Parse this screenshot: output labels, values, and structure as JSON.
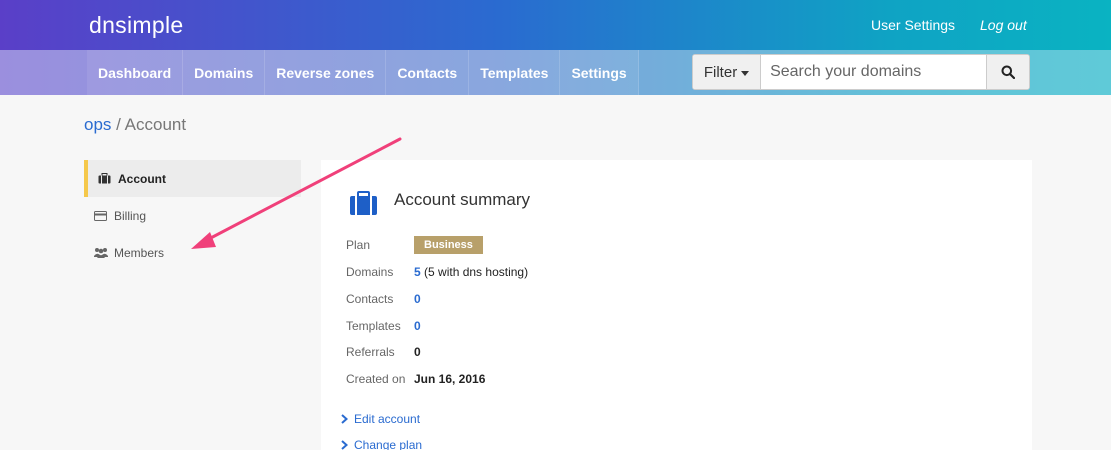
{
  "header": {
    "logo": "dnsimple",
    "user_settings": "User Settings",
    "logout": "Log out"
  },
  "nav": {
    "tabs": [
      {
        "label": "Dashboard"
      },
      {
        "label": "Domains"
      },
      {
        "label": "Reverse zones"
      },
      {
        "label": "Contacts"
      },
      {
        "label": "Templates"
      },
      {
        "label": "Settings"
      }
    ]
  },
  "search": {
    "filter_label": "Filter",
    "placeholder": "Search your domains",
    "value": ""
  },
  "breadcrumb": {
    "account_name": "ops",
    "separator": " / ",
    "current": "Account"
  },
  "sidebar": {
    "items": [
      {
        "label": "Account",
        "icon": "briefcase-icon",
        "active": true
      },
      {
        "label": "Billing",
        "icon": "credit-card-icon",
        "active": false
      },
      {
        "label": "Members",
        "icon": "users-icon",
        "active": false
      }
    ]
  },
  "summary": {
    "title": "Account summary",
    "rows": [
      {
        "label": "Plan",
        "value": "Business"
      },
      {
        "label": "Domains",
        "value": "5",
        "extra": "(5 with dns hosting)"
      },
      {
        "label": "Contacts",
        "value": "0"
      },
      {
        "label": "Templates",
        "value": "0"
      },
      {
        "label": "Referrals",
        "value": "0"
      },
      {
        "label": "Created on",
        "value": "Jun 16, 2016"
      }
    ],
    "actions": [
      {
        "label": "Edit account"
      },
      {
        "label": "Change plan"
      }
    ]
  },
  "colors": {
    "accent": "#2a6bd0",
    "active_marker": "#f5c84b",
    "plan_badge": "#b8a06a",
    "annotation_arrow": "#f0407a"
  }
}
